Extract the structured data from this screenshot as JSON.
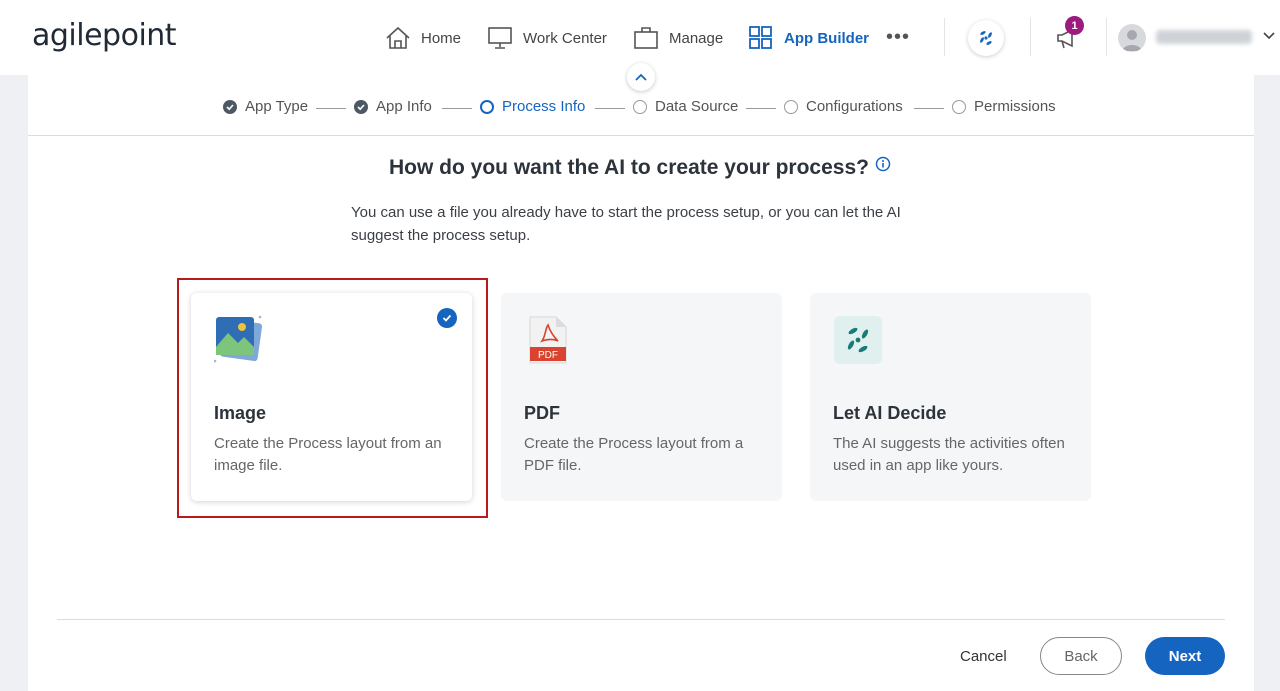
{
  "brand": {
    "logo_text": "agilepoint"
  },
  "nav": {
    "home": "Home",
    "work_center": "Work Center",
    "manage": "Manage",
    "app_builder": "App Builder",
    "more": "•••",
    "notification_count": "1"
  },
  "steps": [
    {
      "label": "App Type",
      "state": "done"
    },
    {
      "label": "App Info",
      "state": "done"
    },
    {
      "label": "Process Info",
      "state": "current"
    },
    {
      "label": "Data Source",
      "state": "todo"
    },
    {
      "label": "Configurations",
      "state": "todo"
    },
    {
      "label": "Permissions",
      "state": "todo"
    }
  ],
  "main": {
    "heading": "How do you want the AI to create your process?",
    "subtext": "You can use a file you already have to start the process setup, or you can let the AI suggest the process setup."
  },
  "cards": [
    {
      "title": "Image",
      "desc": "Create the Process layout from an image file.",
      "icon": "image-file-icon",
      "selected": true
    },
    {
      "title": "PDF",
      "desc": "Create the Process layout from a PDF file.",
      "icon": "pdf-file-icon",
      "selected": false
    },
    {
      "title": "Let AI Decide",
      "desc": "The AI suggests the activities often used in an app like yours.",
      "icon": "ai-sparkle-icon",
      "selected": false
    }
  ],
  "pdf_icon_label": "PDF",
  "footer": {
    "cancel": "Cancel",
    "back": "Back",
    "next": "Next"
  },
  "colors": {
    "accent": "#1565c0",
    "highlight": "#b71c1c",
    "badge": "#9c1b7f"
  }
}
